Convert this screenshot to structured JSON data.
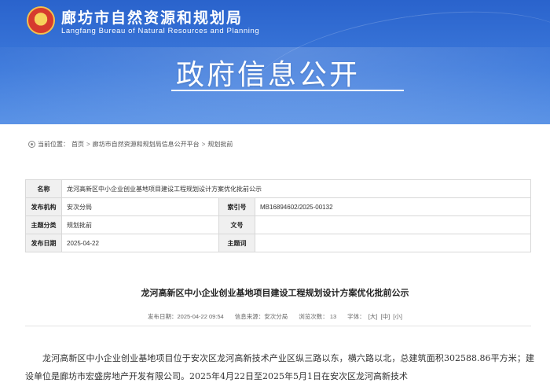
{
  "header": {
    "org_name_cn": "廊坊市自然资源和规划局",
    "org_name_en": "Langfang Bureau of Natural Resources and Planning",
    "section_title": "政府信息公开"
  },
  "breadcrumb": {
    "prefix": "当前位置：",
    "items": [
      "首页",
      "廊坊市自然资源和规划局信息公开平台",
      "规划批前"
    ],
    "separator": ">"
  },
  "meta": {
    "name_label": "名称",
    "name_value": "龙河高新区中小企业创业基地项目建设工程规划设计方案优化批前公示",
    "publisher_label": "发布机构",
    "publisher_value": "安次分局",
    "index_label": "索引号",
    "index_value": "MB16894602/2025-00132",
    "category_label": "主题分类",
    "category_value": "规划批前",
    "docno_label": "文号",
    "docno_value": "",
    "date_label": "发布日期",
    "date_value": "2025-04-22",
    "keywords_label": "主题词",
    "keywords_value": ""
  },
  "article": {
    "title": "龙河高新区中小企业创业基地项目建设工程规划设计方案优化批前公示",
    "publish_time": "发布日期：2025-04-22 09:54",
    "source": "信息来源：安次分局",
    "views": "浏览次数： 13",
    "font_label": "字体：",
    "font_sizes": [
      "[大]",
      "[中]",
      "[小]"
    ],
    "body": "龙河高新区中小企业创业基地项目位于安次区龙河高新技术产业区纵三路以东，横六路以北，总建筑面积302588.86平方米；建设单位是廊坊市宏盛房地产开发有限公司。2025年4月22日至2025年5月1日在安次区龙河高新技术"
  },
  "colors": {
    "banner": "#3a76d9",
    "label_bg": "#f0f0f0",
    "border": "#d8d8d8"
  }
}
